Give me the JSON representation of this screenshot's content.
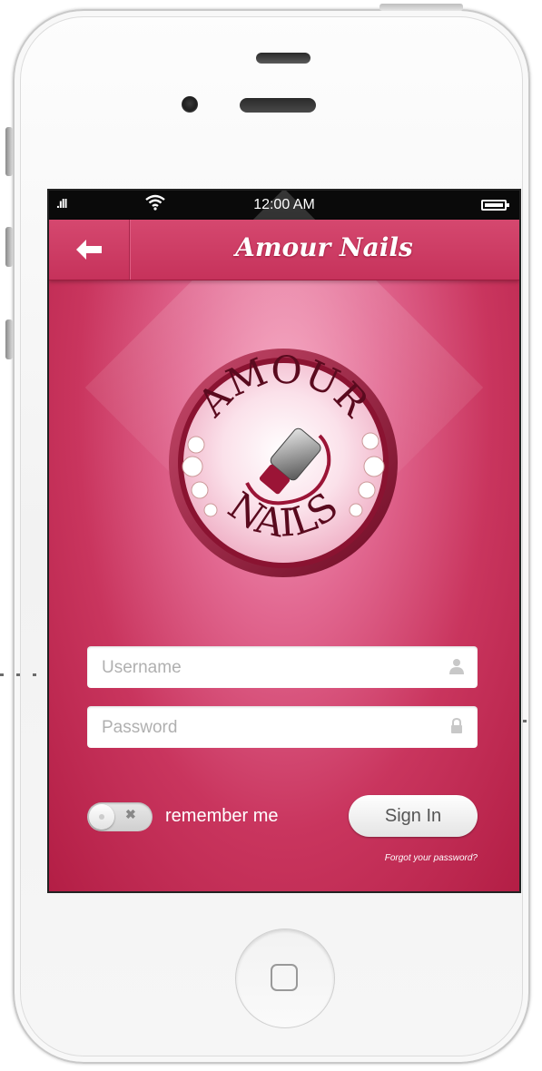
{
  "status_bar": {
    "signal": ".ıll",
    "wifi_icon": "wifi-icon",
    "time": "12:00 AM",
    "battery_icon": "battery-icon"
  },
  "nav": {
    "back_label": "🡐",
    "title": "Amour Nails"
  },
  "logo": {
    "top_text": "AMOUR",
    "bottom_text": "NAILS"
  },
  "form": {
    "username_placeholder": "Username",
    "password_placeholder": "Password",
    "remember_label": "remember me",
    "toggle_off_glyph": "✖",
    "signin_label": "Sign In",
    "forgot_label": "Forgot your password?"
  },
  "colors": {
    "brand_pink": "#c9355e",
    "nav_pink": "#d5486f"
  }
}
